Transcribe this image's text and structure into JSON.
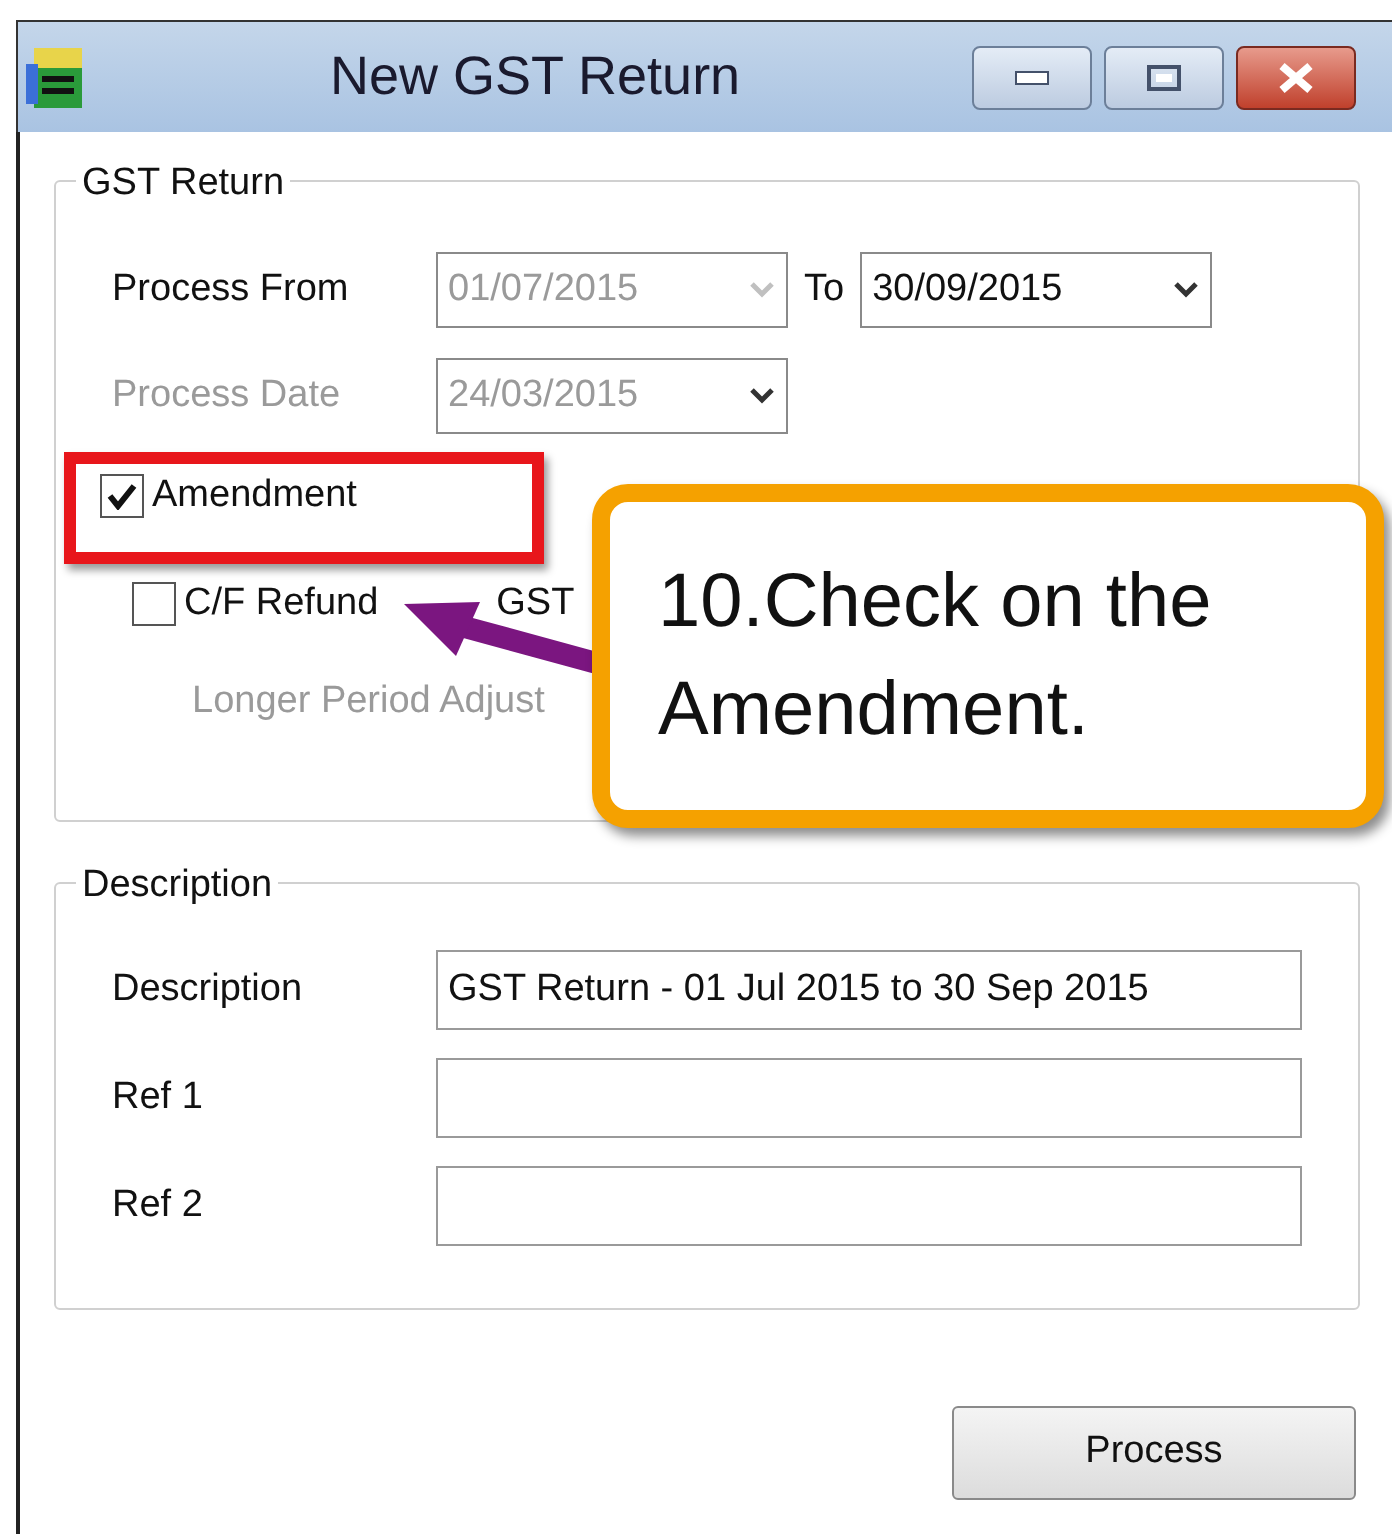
{
  "window": {
    "title": "New GST Return"
  },
  "gst_return": {
    "title": "GST Return",
    "process_from": {
      "label": "Process From",
      "value": "01/07/2015",
      "disabled": true
    },
    "to": {
      "label": "To",
      "value": "30/09/2015",
      "disabled": false
    },
    "process_date": {
      "label": "Process Date",
      "value": "24/03/2015",
      "disabled": true
    },
    "checkboxes": [
      {
        "label": "Amendment",
        "checked": true
      },
      {
        "label": "C/F Refund",
        "label_end": "GST",
        "checked": false
      }
    ],
    "longer_period": {
      "label": "Longer Period Adjust",
      "disabled": true
    }
  },
  "description": {
    "title": "Description",
    "fields": [
      {
        "label": "Description",
        "value": "GST Return - 01 Jul 2015 to 30 Sep 2015"
      },
      {
        "label": "Ref 1"
      },
      {
        "label": "Ref 2"
      }
    ]
  },
  "buttons": [
    "Process"
  ],
  "callout": {
    "text": "10.Check on the Amendment."
  }
}
